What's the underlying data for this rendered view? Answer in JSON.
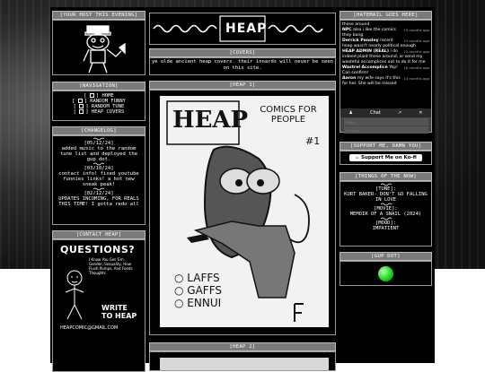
{
  "left": {
    "host_title": "[YOUR HOST THIS EVENING]",
    "nav_title": "[NAVIGATION]",
    "nav_items": [
      "HOME",
      "RANDOM FUNNY",
      "RANDOM TUNE",
      "HEAP COVERS"
    ],
    "changelog_title": "[CHANGELOG]",
    "changelog": [
      {
        "date": "[05/12/24]",
        "text": "added music to the random tune list and deployed the gup dot."
      },
      {
        "date": "[03/10/24]",
        "text": "contact info! fixed youtube funnies links! a hot new sneak peak!"
      },
      {
        "date": "[02/12/24]",
        "text": "UPDATES INCOMING, FOR REALS THIS TIME! I gotta redo all"
      }
    ],
    "contact_title": "[CONTACT HEAP]",
    "poster_title": "QUESTIONS?",
    "poster_lines": [
      "I Know You Got 'Em.",
      "Gender, Sexuality, How",
      "Flush Pumps, And Foods",
      "Thoughts"
    ],
    "poster_write": "WRITE TO HEAP",
    "poster_email": "HEAPCOMIC@GMAIL.COM"
  },
  "center": {
    "logo_text": "HEAP",
    "covers_title": "[COVERS]",
    "covers_text": "ye olde ancient heap covers. their innards will never be seen on this site.",
    "heap1_title": "[HEAP 1]",
    "cover1_logo": "HEAP",
    "cover1_tagline": "COMICS FOR PEOPLE",
    "cover1_number": "#1",
    "cover1_list": [
      "LAFFS",
      "GAFFS",
      "ENNUI"
    ],
    "heap2_title": "[HEAP 2]"
  },
  "right": {
    "hatemail_title": "[HATEMAIL GOES HERE]",
    "messages": [
      {
        "name": "",
        "text": "these around",
        "time": ""
      },
      {
        "name": "NPC",
        "text": "also i like the comics they bang",
        "time": "15 months ago"
      },
      {
        "name": "Derrick Pensley",
        "text": "recent heap wasn't nearly political enough",
        "time": "15 months ago"
      },
      {
        "name": "HEAP ADMIN (REAL)",
        "text": "i do indeed plant these around, or send my wasteful accomplices out to do it for me",
        "time": "15 months ago"
      },
      {
        "name": "Wastrel Accomplice",
        "text": "Yep! Can confirm!",
        "time": "16 months ago"
      },
      {
        "name": "Aaron",
        "text": "my wife says it's this for her. She will be missed",
        "time": "14 months ago"
      }
    ],
    "chat_button": "Chat",
    "chat_name_placeholder": "Name",
    "chat_msg_placeholder": "message",
    "support_title": "[SUPPORT ME, DAMN YOU]",
    "kofi_label": "Support Me on Ko-fi",
    "things_title": "[THINGS OF THE NOW]",
    "tune_label": "[TUNE]:",
    "tune": "KURT BAKER- DON'T GO FALLING IN LOVE",
    "movie_label": "[MOVIE]:",
    "movie": "MEMOIR OF A SNAIL (2024)",
    "mood_label": "[MOOD]:",
    "mood": "IMPATIENT",
    "gup_title": "[GUP DOT]",
    "gup_color": "#2fe32f"
  }
}
